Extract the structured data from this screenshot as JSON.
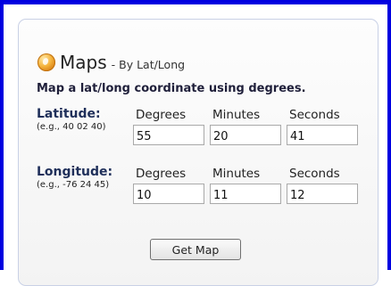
{
  "widget": {
    "title": "Maps",
    "subtitle": "- By Lat/Long",
    "icon": "maps-globe-icon",
    "instruction": "Map a lat/long coordinate using degrees."
  },
  "latitude": {
    "label": "Latitude:",
    "example": "(e.g., 40 02 40)",
    "columns": [
      "Degrees",
      "Minutes",
      "Seconds"
    ],
    "values": {
      "degrees": "55",
      "minutes": "20",
      "seconds": "41"
    }
  },
  "longitude": {
    "label": "Longitude:",
    "example": "(e.g., -76 24 45)",
    "columns": [
      "Degrees",
      "Minutes",
      "Seconds"
    ],
    "values": {
      "degrees": "10",
      "minutes": "11",
      "seconds": "12"
    }
  },
  "actions": {
    "get_map_label": "Get Map"
  },
  "colors": {
    "frame_border": "#0000e0",
    "label_text": "#1f2f5a"
  }
}
